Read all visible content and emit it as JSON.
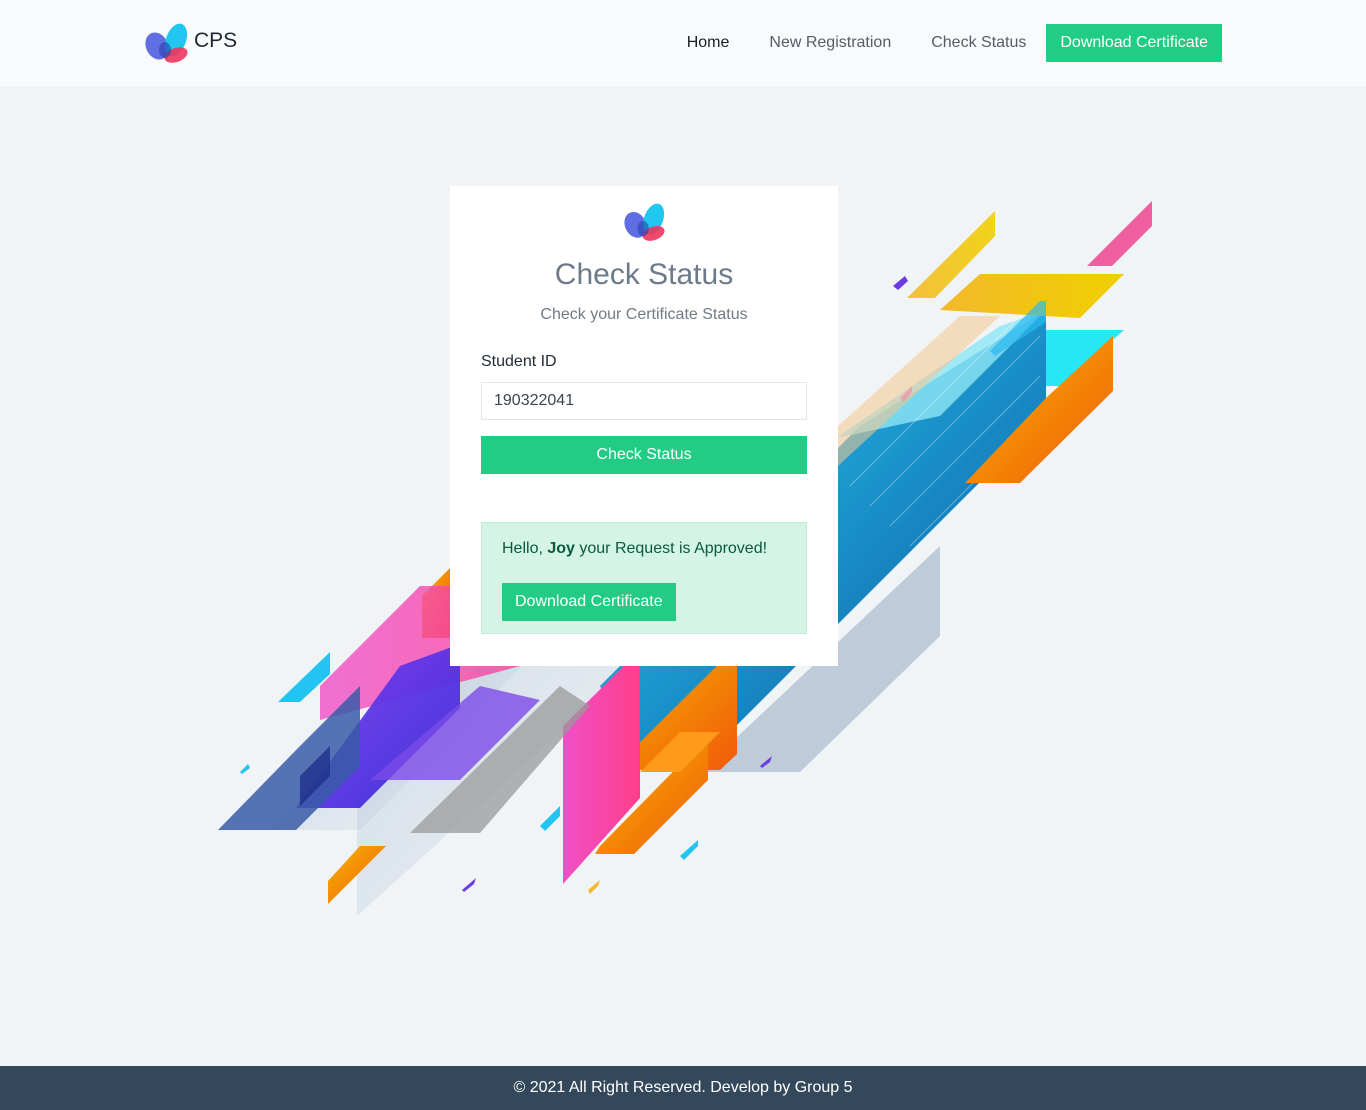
{
  "nav": {
    "brand": "CPS",
    "links": [
      "Home",
      "New Registration",
      "Check Status"
    ],
    "cta": "Download Certificate"
  },
  "card": {
    "title": "Check Status",
    "subtitle": "Check your Certificate Status",
    "field_label": "Student ID",
    "field_value": "190322041",
    "submit": "Check Status",
    "alert": {
      "greeting": "Hello, ",
      "name": "Joy",
      "message": " your Request is Approved!",
      "button": "Download Certificate"
    }
  },
  "footer": {
    "text": "© 2021 All Right Reserved. Develop by Group 5"
  },
  "colors": {
    "accent_green": "#22cc84",
    "footer_bg": "#33485b",
    "alert_bg": "#d4f4e6",
    "page_bg": "#f0f4f7"
  },
  "icons": [
    "butterfly-logo-icon"
  ]
}
